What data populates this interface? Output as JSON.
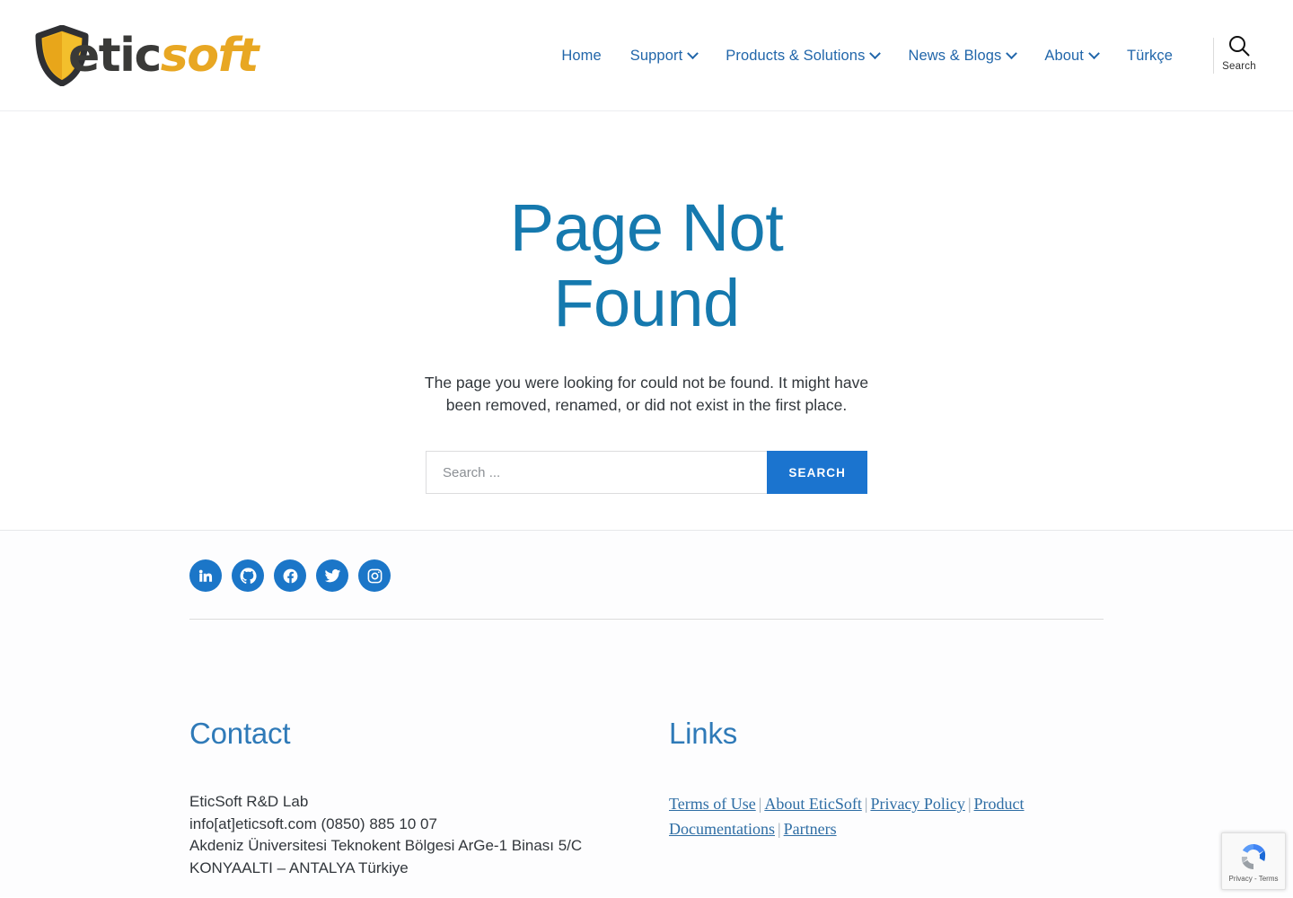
{
  "brand": {
    "logo_etic": "etic",
    "logo_soft": "soft",
    "shield_color": "#efb21f",
    "shield_outline": "#2f3033",
    "word_dark": "#3a3a38",
    "word_gold": "#e8a723"
  },
  "header": {
    "nav": [
      {
        "label": "Home",
        "has_caret": false
      },
      {
        "label": "Support",
        "has_caret": true
      },
      {
        "label": "Products & Solutions",
        "has_caret": true
      },
      {
        "label": "News & Blogs",
        "has_caret": true
      },
      {
        "label": "About",
        "has_caret": true
      },
      {
        "label": "Türkçe",
        "has_caret": false
      }
    ],
    "search_toggle_label": "Search",
    "nav_color": "#2166aa"
  },
  "main": {
    "title_line1": "Page Not",
    "title_line2": "Found",
    "title_color": "#1579ae",
    "description": "The page you were looking for could not be found. It might have been removed, renamed, or did not exist in the first place.",
    "search_placeholder": "Search ...",
    "search_value": "",
    "search_button": "SEARCH",
    "search_button_color": "#1b74cf"
  },
  "footer": {
    "social": [
      {
        "name": "linkedin",
        "title": "LinkedIn"
      },
      {
        "name": "github",
        "title": "GitHub"
      },
      {
        "name": "facebook",
        "title": "Facebook"
      },
      {
        "name": "twitter",
        "title": "Twitter"
      },
      {
        "name": "instagram",
        "title": "Instagram"
      }
    ],
    "social_color": "#1b76c8",
    "contact": {
      "heading": "Contact",
      "line1": "EticSoft R&D Lab",
      "line2": "info[at]eticsoft.com (0850) 885 10 07",
      "line3": "Akdeniz Üniversitesi Teknokent Bölgesi ArGe-1 Binası 5/C",
      "line4": "KONYAALTI – ANTALYA Türkiye"
    },
    "links": {
      "heading": "Links",
      "separator": "|",
      "items": [
        "Terms of Use",
        "About EticSoft",
        "Privacy Policy",
        "Product Documentations",
        "Partners"
      ]
    },
    "heading_color": "#2f7ab8"
  },
  "recaptcha": {
    "text": "Privacy - Terms"
  }
}
